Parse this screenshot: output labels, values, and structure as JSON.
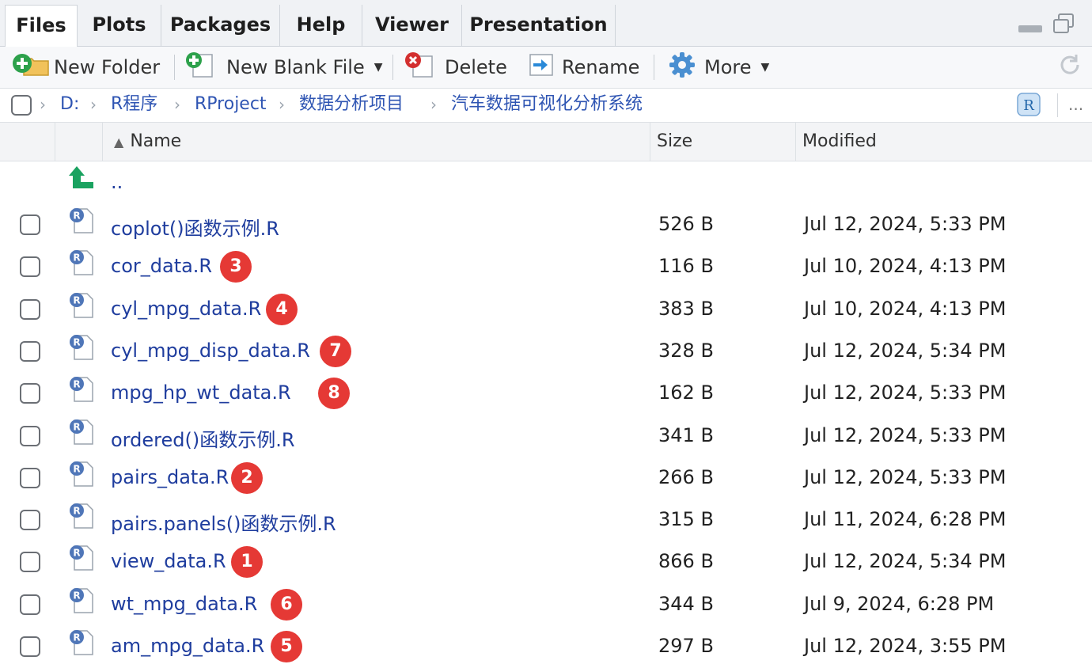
{
  "tabs": [
    "Files",
    "Plots",
    "Packages",
    "Help",
    "Viewer",
    "Presentation"
  ],
  "toolbar": {
    "new_folder": "New Folder",
    "new_blank_file": "New Blank File",
    "delete": "Delete",
    "rename": "Rename",
    "more": "More"
  },
  "breadcrumb": [
    "D:",
    "R程序",
    "RProject",
    "数据分析项目",
    "汽车数据可视化分析系统"
  ],
  "breadcrumb_more": "...",
  "columns": {
    "name": "Name",
    "size": "Size",
    "modified": "Modified"
  },
  "parent_dir": "..",
  "files": [
    {
      "name": "coplot()函数示例.R",
      "size": "526 B",
      "modified": "Jul 12, 2024, 5:33 PM",
      "badge": ""
    },
    {
      "name": "cor_data.R",
      "size": "116 B",
      "modified": "Jul 10, 2024, 4:13 PM",
      "badge": "3"
    },
    {
      "name": "cyl_mpg_data.R",
      "size": "383 B",
      "modified": "Jul 10, 2024, 4:13 PM",
      "badge": "4"
    },
    {
      "name": "cyl_mpg_disp_data.R",
      "size": "328 B",
      "modified": "Jul 12, 2024, 5:34 PM",
      "badge": "7"
    },
    {
      "name": "mpg_hp_wt_data.R",
      "size": "162 B",
      "modified": "Jul 12, 2024, 5:33 PM",
      "badge": "8"
    },
    {
      "name": "ordered()函数示例.R",
      "size": "341 B",
      "modified": "Jul 12, 2024, 5:33 PM",
      "badge": ""
    },
    {
      "name": "pairs_data.R",
      "size": "266 B",
      "modified": "Jul 12, 2024, 5:33 PM",
      "badge": "2"
    },
    {
      "name": "pairs.panels()函数示例.R",
      "size": "315 B",
      "modified": "Jul 11, 2024, 6:28 PM",
      "badge": ""
    },
    {
      "name": "view_data.R",
      "size": "866 B",
      "modified": "Jul 12, 2024, 5:34 PM",
      "badge": "1"
    },
    {
      "name": "wt_mpg_data.R",
      "size": "344 B",
      "modified": "Jul 9, 2024, 6:28 PM",
      "badge": "6"
    },
    {
      "name": "am_mpg_data.R",
      "size": "297 B",
      "modified": "Jul 12, 2024, 3:55 PM",
      "badge": "5"
    }
  ],
  "colors": {
    "link": "#1f3d9e",
    "badge": "#e53935",
    "up_arrow": "#1aa260"
  }
}
